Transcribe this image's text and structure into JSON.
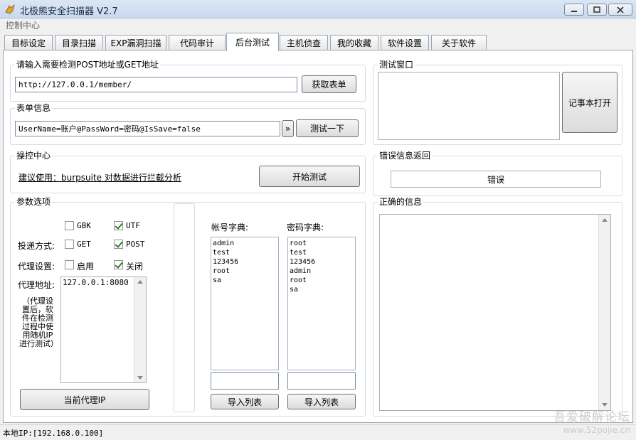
{
  "window": {
    "title": "北极熊安全扫描器 V2.7"
  },
  "menu": {
    "item": "控制中心"
  },
  "tabs": [
    {
      "label": "目标设定"
    },
    {
      "label": "目录扫描"
    },
    {
      "label": "EXP漏洞扫描"
    },
    {
      "label": "代码审计"
    },
    {
      "label": "后台测试"
    },
    {
      "label": "主机侦查"
    },
    {
      "label": "我的收藏"
    },
    {
      "label": "软件设置"
    },
    {
      "label": "关于软件"
    }
  ],
  "url_group": {
    "title": "请输入需要检测POST地址或GET地址",
    "url_value": "http://127.0.0.1/member/",
    "fetch_button": "获取表单"
  },
  "form_group": {
    "title": "表单信息",
    "form_value": "UserName=账户@PassWord=密码@IsSave=false",
    "more_button": "»",
    "test_button": "测试一下"
  },
  "control_group": {
    "title": "操控中心",
    "hint": "建议使用：burpsuite 对数据进行拦截分析",
    "start_button": "开始测试"
  },
  "params_group": {
    "title": "参数选项",
    "encoding": {
      "gbk": "GBK",
      "utf": "UTF"
    },
    "method_label": "投递方式:",
    "method": {
      "get": "GET",
      "post": "POST"
    },
    "proxy_label": "代理设置:",
    "proxy": {
      "on": "启用",
      "off": "关闭"
    },
    "proxy_addr_label": "代理地址:",
    "proxy_note": "（代理设置后，软件在检测过程中使用随机IP进行测试）",
    "proxy_list": [
      "127.0.0.1:8080"
    ],
    "current_proxy_button": "当前代理IP"
  },
  "dict": {
    "account_label": "帐号字典:",
    "password_label": "密码字典:",
    "accounts": [
      "admin",
      "test",
      "123456",
      "root",
      "sa"
    ],
    "passwords": [
      "root",
      "test",
      "123456",
      "admin",
      "root",
      "sa"
    ],
    "import_button": "导入列表"
  },
  "test_window": {
    "title": "测试窗口",
    "notepad_button": "记事本打开"
  },
  "error_group": {
    "title": "错误信息返回",
    "error_value": "错误"
  },
  "correct_group": {
    "title": "正确的信息"
  },
  "status": {
    "text": "本地IP:[192.168.0.100]"
  },
  "watermark": {
    "line1": "吾爱破解论坛",
    "line2": "www.52pojie.cn"
  },
  "colors": {
    "titlebar": "#c9d9ee",
    "panel": "#ffffff",
    "accent": "#7a8ea8"
  }
}
